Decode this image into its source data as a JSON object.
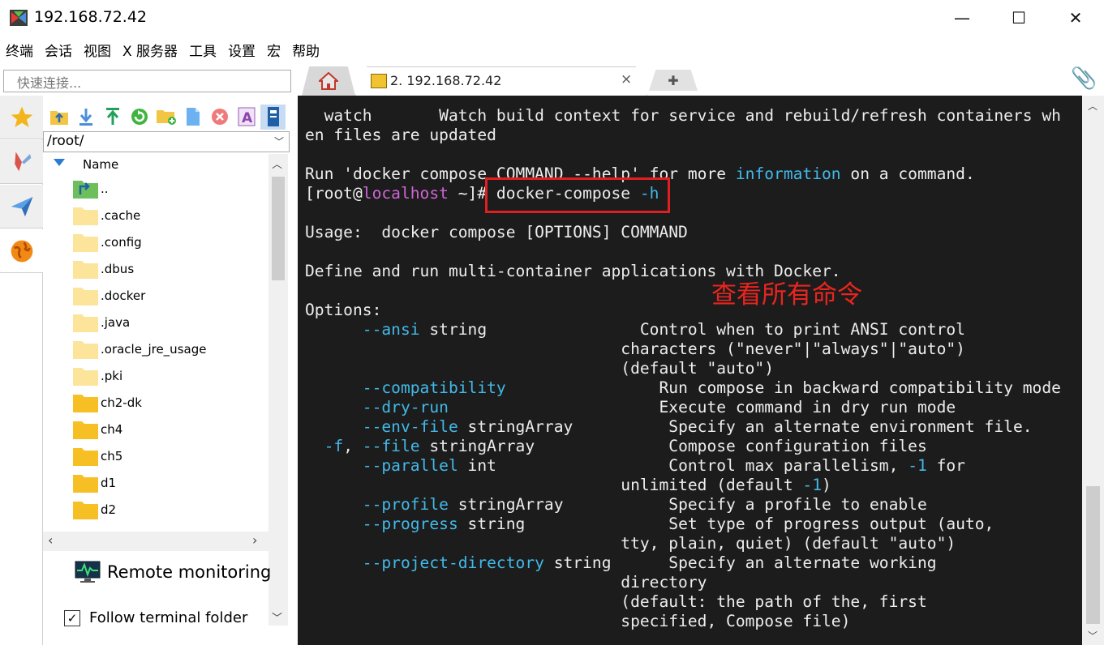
{
  "window": {
    "title": "192.168.72.42",
    "minimize": "—",
    "maximize": "☐",
    "close": "✕"
  },
  "menu": [
    "终端",
    "会话",
    "视图",
    "X 服务器",
    "工具",
    "设置",
    "宏",
    "帮助"
  ],
  "quick_connect": {
    "placeholder": "快速连接..."
  },
  "side_tabs": [
    "star-icon",
    "tools-icon",
    "send-icon",
    "globe-icon"
  ],
  "file_toolbar": [
    "upload-up-icon",
    "download-icon",
    "upload-icon",
    "refresh-icon",
    "new-folder-icon",
    "new-file-icon",
    "delete-icon",
    "rename-icon",
    "bookmark-icon"
  ],
  "path": "/root/",
  "tree": {
    "header": "Name",
    "items": [
      {
        "name": "..",
        "type": "up"
      },
      {
        "name": ".cache",
        "type": "hidden"
      },
      {
        "name": ".config",
        "type": "hidden"
      },
      {
        "name": ".dbus",
        "type": "hidden"
      },
      {
        "name": ".docker",
        "type": "hidden"
      },
      {
        "name": ".java",
        "type": "hidden"
      },
      {
        "name": ".oracle_jre_usage",
        "type": "hidden"
      },
      {
        "name": ".pki",
        "type": "hidden"
      },
      {
        "name": "ch2-dk",
        "type": "folder"
      },
      {
        "name": "ch4",
        "type": "folder"
      },
      {
        "name": "ch5",
        "type": "folder"
      },
      {
        "name": "d1",
        "type": "folder"
      },
      {
        "name": "d2",
        "type": "folder"
      }
    ]
  },
  "remote_monitoring": "Remote monitoring",
  "follow_terminal": {
    "label": "Follow terminal folder",
    "checked": true
  },
  "tabs": {
    "session_label": "2. 192.168.72.42",
    "close": "×"
  },
  "terminal_lines": [
    [
      [
        "  watch       Watch build context for service and rebuild/refresh containers wh",
        ""
      ]
    ],
    [
      [
        "en files are updated",
        ""
      ]
    ],
    [
      [
        "",
        ""
      ]
    ],
    [
      [
        "Run 'docker compose COMMAND --help' for more ",
        ""
      ],
      [
        "information",
        "cy"
      ],
      [
        " on a command.",
        ""
      ]
    ],
    [
      [
        "[root@",
        ""
      ],
      [
        "localhost",
        "mg"
      ],
      [
        " ~]# docker-compose ",
        ""
      ],
      [
        "-h",
        "cy"
      ]
    ],
    [
      [
        "",
        ""
      ]
    ],
    [
      [
        "Usage:  docker compose [OPTIONS] COMMAND",
        ""
      ]
    ],
    [
      [
        "",
        ""
      ]
    ],
    [
      [
        "Define and run multi-container applications with Docker.",
        ""
      ]
    ],
    [
      [
        "",
        ""
      ]
    ],
    [
      [
        "Options:",
        ""
      ]
    ],
    [
      [
        "      ",
        ""
      ],
      [
        "--ansi",
        "cy"
      ],
      [
        " string                Control when to print ANSI control",
        ""
      ]
    ],
    [
      [
        "                                 characters (\"never\"|\"always\"|\"auto\")",
        ""
      ]
    ],
    [
      [
        "                                 (default \"auto\")",
        ""
      ]
    ],
    [
      [
        "      ",
        ""
      ],
      [
        "--compatibility",
        "cy"
      ],
      [
        "                Run compose in backward compatibility mode",
        ""
      ]
    ],
    [
      [
        "      ",
        ""
      ],
      [
        "--dry-run",
        "cy"
      ],
      [
        "                      Execute command in dry run mode",
        ""
      ]
    ],
    [
      [
        "      ",
        ""
      ],
      [
        "--env-file",
        "cy"
      ],
      [
        " stringArray          Specify an alternate environment file.",
        ""
      ]
    ],
    [
      [
        "  ",
        ""
      ],
      [
        "-f",
        "cy"
      ],
      [
        ", ",
        ""
      ],
      [
        "--file",
        "cy"
      ],
      [
        " stringArray              Compose configuration files",
        ""
      ]
    ],
    [
      [
        "      ",
        ""
      ],
      [
        "--parallel",
        "cy"
      ],
      [
        " int                  Control max parallelism, ",
        ""
      ],
      [
        "-1",
        "cy"
      ],
      [
        " for",
        ""
      ]
    ],
    [
      [
        "                                 unlimited (default ",
        ""
      ],
      [
        "-1",
        "cy"
      ],
      [
        ")",
        ""
      ]
    ],
    [
      [
        "      ",
        ""
      ],
      [
        "--profile",
        "cy"
      ],
      [
        " stringArray           Specify a profile to enable",
        ""
      ]
    ],
    [
      [
        "      ",
        ""
      ],
      [
        "--progress",
        "cy"
      ],
      [
        " string               Set type of progress output (auto,",
        ""
      ]
    ],
    [
      [
        "                                 tty, plain, quiet) (default \"auto\")",
        ""
      ]
    ],
    [
      [
        "      ",
        ""
      ],
      [
        "--project-directory",
        "cy"
      ],
      [
        " string      Specify an alternate working",
        ""
      ]
    ],
    [
      [
        "                                 directory",
        ""
      ]
    ],
    [
      [
        "                                 (default: the path of the, first",
        ""
      ]
    ],
    [
      [
        "                                 specified, Compose file)",
        ""
      ]
    ]
  ],
  "annotation": "查看所有命令",
  "colors": {
    "terminal_bg": "#1c1c1c",
    "cyan": "#42b9e8",
    "magenta": "#d065d6",
    "annotation_red": "#e8251f"
  }
}
